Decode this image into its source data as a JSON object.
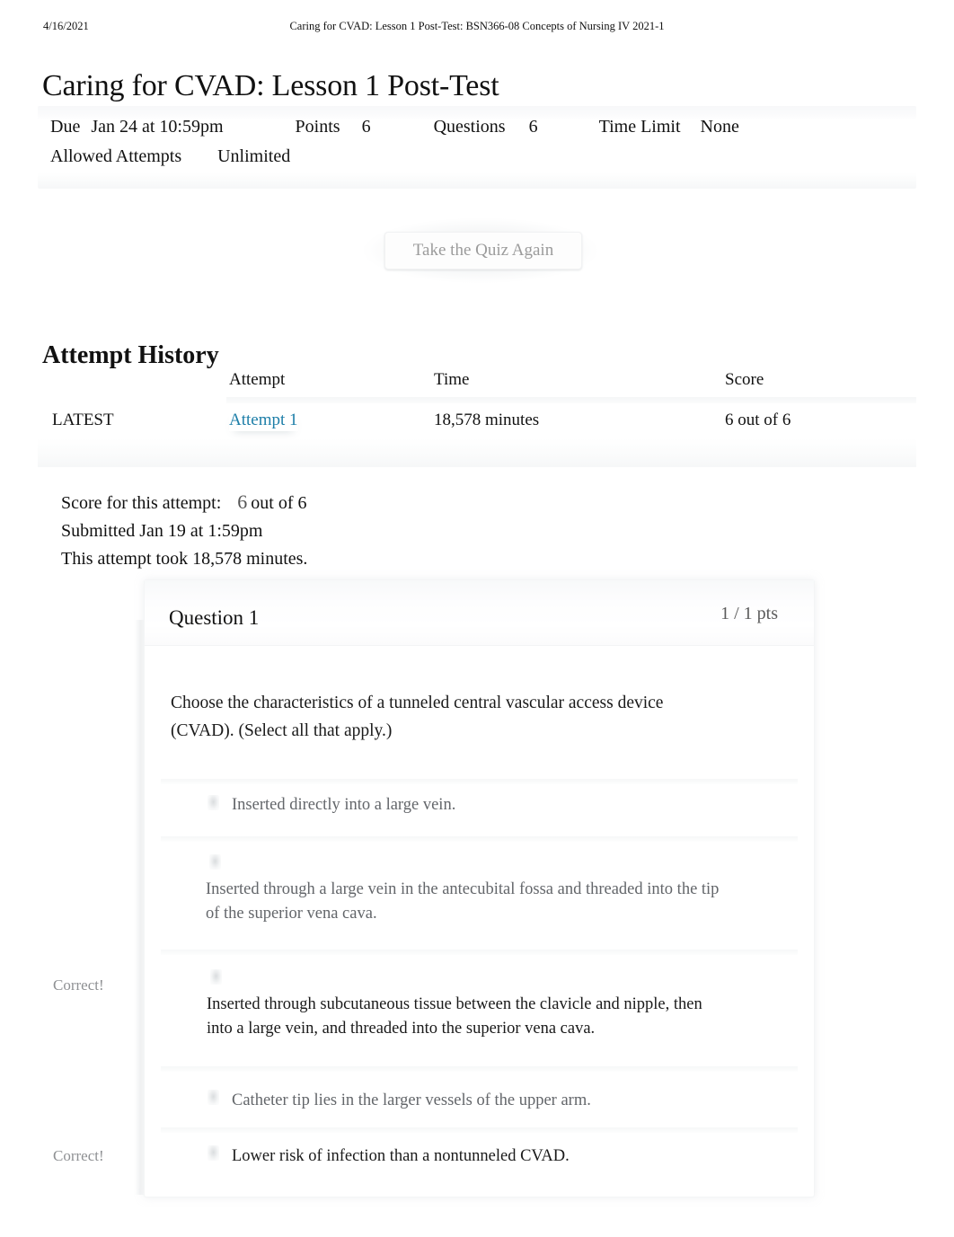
{
  "print_header": {
    "date": "4/16/2021",
    "document_title": "Caring for CVAD: Lesson 1 Post-Test: BSN366-08 Concepts of Nursing IV 2021-1"
  },
  "page_title": "Caring for CVAD: Lesson 1 Post-Test",
  "quiz_meta": {
    "due_label": "Due",
    "due_value": "Jan 24 at 10:59pm",
    "points_label": "Points",
    "points_value": "6",
    "questions_label": "Questions",
    "questions_value": "6",
    "time_limit_label": "Time Limit",
    "time_limit_value": "None",
    "allowed_attempts_label": "Allowed Attempts",
    "allowed_attempts_value": "Unlimited"
  },
  "retake_button": {
    "label": "Take the Quiz Again"
  },
  "attempt_history": {
    "heading": "Attempt History",
    "columns": {
      "kept": "",
      "attempt": "Attempt",
      "time": "Time",
      "score": "Score"
    },
    "rows": [
      {
        "kept": "LATEST",
        "attempt": "Attempt 1",
        "time": "18,578 minutes",
        "score": "6 out of 6"
      }
    ]
  },
  "score_summary": {
    "score_label": "Score for this attempt:",
    "score_value": "6",
    "score_out_of": "out of 6",
    "submitted": "Submitted Jan 19 at 1:59pm",
    "duration": "This attempt took 18,578 minutes."
  },
  "question": {
    "title": "Question 1",
    "points": "1 / 1 pts",
    "text": "Choose the characteristics of a tunneled central vascular access device (CVAD). (Select all that apply.)",
    "correct_flag_label": "Correct!",
    "answers": [
      {
        "text": "Inserted directly into a large vein.",
        "selected": false,
        "emphasis": "dim",
        "flag": ""
      },
      {
        "text": "Inserted through a large vein in the antecubital fossa and threaded into the tip of the superior vena cava.",
        "selected": false,
        "emphasis": "dim",
        "flag": ""
      },
      {
        "text": "Inserted through subcutaneous tissue between the clavicle and nipple, then into a large vein, and threaded into the superior vena cava.",
        "selected": true,
        "emphasis": "dark",
        "flag": "Correct!"
      },
      {
        "text": "Catheter tip lies in the larger vessels of the upper arm.",
        "selected": false,
        "emphasis": "dim",
        "flag": ""
      },
      {
        "text": "Lower risk of infection than a nontunneled CVAD.",
        "selected": true,
        "emphasis": "dark",
        "flag": "Correct!"
      }
    ]
  },
  "colors": {
    "link": "#1d7ea8",
    "text": "#1a1a1a",
    "muted": "#63666a",
    "flag": "#8e9093",
    "button_text": "#9b9b9b"
  }
}
